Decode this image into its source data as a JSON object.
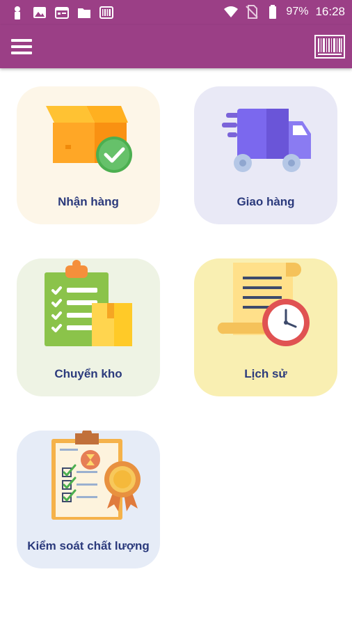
{
  "status_bar": {
    "battery": "97%",
    "time": "16:28",
    "icons": [
      "user-icon",
      "image-icon",
      "calendar-icon",
      "folder-icon",
      "barcode-icon",
      "wifi-icon",
      "no-sim-icon",
      "battery-icon"
    ]
  },
  "app_bar": {
    "menu_icon": "hamburger-menu-icon",
    "scan_icon": "barcode-scan-icon",
    "color": "#9b3f86"
  },
  "tiles": [
    {
      "label": "Nhận hàng",
      "icon": "box-check-icon",
      "bg": "#fdf6e8"
    },
    {
      "label": "Giao hàng",
      "icon": "delivery-truck-icon",
      "bg": "#e9e9f6"
    },
    {
      "label": "Chuyển kho",
      "icon": "clipboard-boxes-icon",
      "bg": "#eef3e4"
    },
    {
      "label": "Lịch sử",
      "icon": "scroll-clock-icon",
      "bg": "#f9efb2"
    },
    {
      "label": "Kiểm soát chất lượng",
      "icon": "quality-checklist-icon",
      "bg": "#e6ecf7"
    }
  ]
}
